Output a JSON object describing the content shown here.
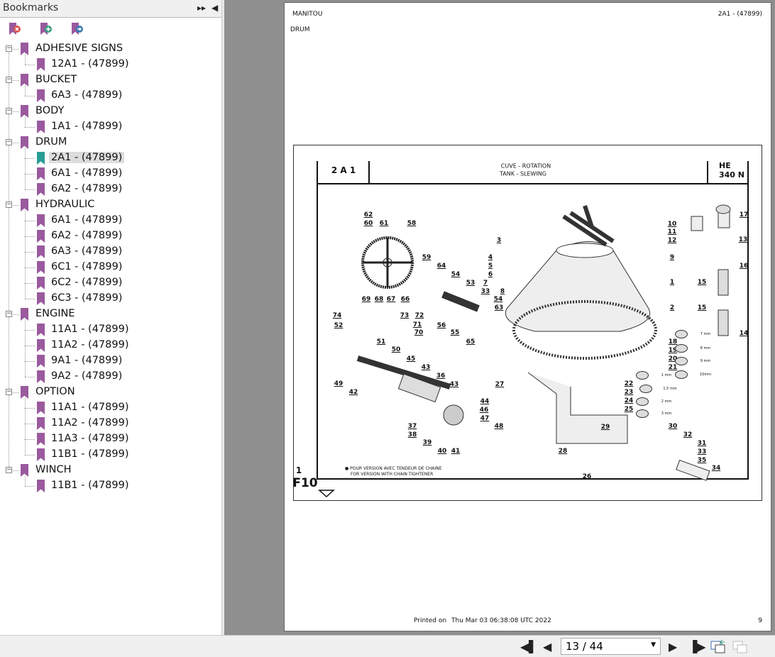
{
  "sidebar": {
    "title": "Bookmarks",
    "groups": [
      {
        "label": "ADHESIVE SIGNS",
        "items": [
          "12A1 - (47899)"
        ]
      },
      {
        "label": "BUCKET",
        "items": [
          "6A3 - (47899)"
        ]
      },
      {
        "label": "BODY",
        "items": [
          "1A1 - (47899)"
        ]
      },
      {
        "label": "DRUM",
        "items": [
          "2A1 - (47899)",
          "6A1 - (47899)",
          "6A2 - (47899)"
        ]
      },
      {
        "label": "HYDRAULIC",
        "items": [
          "6A1 - (47899)",
          "6A2 - (47899)",
          "6A3 - (47899)",
          "6C1 - (47899)",
          "6C2 - (47899)",
          "6C3 - (47899)"
        ]
      },
      {
        "label": "ENGINE",
        "items": [
          "11A1 - (47899)",
          "11A2 - (47899)",
          "9A1 - (47899)",
          "9A2 - (47899)"
        ]
      },
      {
        "label": "OPTION",
        "items": [
          "11A1 - (47899)",
          "11A2 - (47899)",
          "11A3 - (47899)",
          "11B1 - (47899)"
        ]
      },
      {
        "label": "WINCH",
        "items": [
          "11B1 - (47899)"
        ]
      }
    ],
    "selected": "DRUM/2A1 - (47899)"
  },
  "page": {
    "brand": "MANITOU",
    "code": "2A1 - (47899)",
    "section": "DRUM",
    "printed_label": "Printed on",
    "printed_date": "Thu Mar 03 06:38:08 UTC 2022",
    "page_number": "9"
  },
  "diagram": {
    "ref": "2 A 1",
    "title_fr": "CUVE - ROTATION",
    "title_en": "TANK - SLEWING",
    "model": "HE 340 N",
    "sheet": "1",
    "fig": "F10",
    "note_fr": "POUR VERSION AVEC TENDEUR DE CHAINE",
    "note_en": "FOR VERSION WITH CHAIN TIGHTENER",
    "callouts": [
      "62",
      "60",
      "61",
      "58",
      "3",
      "59",
      "4",
      "5",
      "64",
      "6",
      "54",
      "7",
      "53",
      "8",
      "33",
      "54",
      "63",
      "69",
      "68",
      "67",
      "66",
      "74",
      "73",
      "72",
      "52",
      "71",
      "56",
      "55",
      "70",
      "65",
      "51",
      "50",
      "45",
      "43",
      "49",
      "36",
      "43",
      "42",
      "27",
      "44",
      "46",
      "47",
      "48",
      "37",
      "38",
      "39",
      "40",
      "41",
      "10",
      "11",
      "12",
      "17",
      "13",
      "9",
      "16",
      "15",
      "1",
      "2",
      "15",
      "14",
      "18",
      "19",
      "20",
      "21",
      "22",
      "23",
      "24",
      "25",
      "29",
      "30",
      "32",
      "31",
      "33",
      "35",
      "28",
      "34",
      "26"
    ],
    "dims": [
      "7 mm",
      "8 mm",
      "9 mm",
      "10mm",
      "1 mm",
      "1,5 mm",
      "2 mm",
      "3 mm"
    ]
  },
  "toolbar": {
    "page_field": "13 / 44"
  },
  "colors": {
    "bookmark": "#9a5a9e",
    "bookmark_selected": "#2a9d96"
  }
}
